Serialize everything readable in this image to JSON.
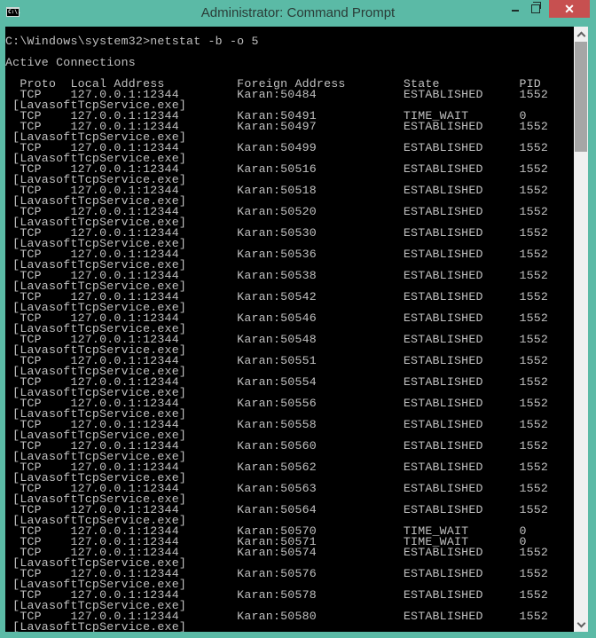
{
  "window": {
    "title": "Administrator: Command Prompt",
    "icon": "cmd-icon",
    "icon_glyph": "C:\\.",
    "controls": {
      "minimize": "minimize-icon",
      "maximize": "restore-icon",
      "close": "close-icon",
      "close_glyph": "✕"
    },
    "colors": {
      "frame": "#5bbaa6",
      "close": "#c75050",
      "console_bg": "#000000",
      "console_fg": "#c0c0c0",
      "scroll_track": "#f0f0f0",
      "scroll_thumb": "#a6a6a6"
    }
  },
  "console": {
    "prompt": "C:\\Windows\\system32>",
    "command": "netstat -b -o 5",
    "section_title": "Active Connections",
    "columns": [
      "Proto",
      "Local Address",
      "Foreign Address",
      "State",
      "PID"
    ],
    "rows": [
      {
        "proto": "TCP",
        "local": "127.0.0.1:12344",
        "foreign": "Karan:50484",
        "state": "ESTABLISHED",
        "pid": "1552",
        "process": "[LavasoftTcpService.exe]"
      },
      {
        "proto": "TCP",
        "local": "127.0.0.1:12344",
        "foreign": "Karan:50491",
        "state": "TIME_WAIT",
        "pid": "0",
        "process": ""
      },
      {
        "proto": "TCP",
        "local": "127.0.0.1:12344",
        "foreign": "Karan:50497",
        "state": "ESTABLISHED",
        "pid": "1552",
        "process": "[LavasoftTcpService.exe]"
      },
      {
        "proto": "TCP",
        "local": "127.0.0.1:12344",
        "foreign": "Karan:50499",
        "state": "ESTABLISHED",
        "pid": "1552",
        "process": "[LavasoftTcpService.exe]"
      },
      {
        "proto": "TCP",
        "local": "127.0.0.1:12344",
        "foreign": "Karan:50516",
        "state": "ESTABLISHED",
        "pid": "1552",
        "process": "[LavasoftTcpService.exe]"
      },
      {
        "proto": "TCP",
        "local": "127.0.0.1:12344",
        "foreign": "Karan:50518",
        "state": "ESTABLISHED",
        "pid": "1552",
        "process": "[LavasoftTcpService.exe]"
      },
      {
        "proto": "TCP",
        "local": "127.0.0.1:12344",
        "foreign": "Karan:50520",
        "state": "ESTABLISHED",
        "pid": "1552",
        "process": "[LavasoftTcpService.exe]"
      },
      {
        "proto": "TCP",
        "local": "127.0.0.1:12344",
        "foreign": "Karan:50530",
        "state": "ESTABLISHED",
        "pid": "1552",
        "process": "[LavasoftTcpService.exe]"
      },
      {
        "proto": "TCP",
        "local": "127.0.0.1:12344",
        "foreign": "Karan:50536",
        "state": "ESTABLISHED",
        "pid": "1552",
        "process": "[LavasoftTcpService.exe]"
      },
      {
        "proto": "TCP",
        "local": "127.0.0.1:12344",
        "foreign": "Karan:50538",
        "state": "ESTABLISHED",
        "pid": "1552",
        "process": "[LavasoftTcpService.exe]"
      },
      {
        "proto": "TCP",
        "local": "127.0.0.1:12344",
        "foreign": "Karan:50542",
        "state": "ESTABLISHED",
        "pid": "1552",
        "process": "[LavasoftTcpService.exe]"
      },
      {
        "proto": "TCP",
        "local": "127.0.0.1:12344",
        "foreign": "Karan:50546",
        "state": "ESTABLISHED",
        "pid": "1552",
        "process": "[LavasoftTcpService.exe]"
      },
      {
        "proto": "TCP",
        "local": "127.0.0.1:12344",
        "foreign": "Karan:50548",
        "state": "ESTABLISHED",
        "pid": "1552",
        "process": "[LavasoftTcpService.exe]"
      },
      {
        "proto": "TCP",
        "local": "127.0.0.1:12344",
        "foreign": "Karan:50551",
        "state": "ESTABLISHED",
        "pid": "1552",
        "process": "[LavasoftTcpService.exe]"
      },
      {
        "proto": "TCP",
        "local": "127.0.0.1:12344",
        "foreign": "Karan:50554",
        "state": "ESTABLISHED",
        "pid": "1552",
        "process": "[LavasoftTcpService.exe]"
      },
      {
        "proto": "TCP",
        "local": "127.0.0.1:12344",
        "foreign": "Karan:50556",
        "state": "ESTABLISHED",
        "pid": "1552",
        "process": "[LavasoftTcpService.exe]"
      },
      {
        "proto": "TCP",
        "local": "127.0.0.1:12344",
        "foreign": "Karan:50558",
        "state": "ESTABLISHED",
        "pid": "1552",
        "process": "[LavasoftTcpService.exe]"
      },
      {
        "proto": "TCP",
        "local": "127.0.0.1:12344",
        "foreign": "Karan:50560",
        "state": "ESTABLISHED",
        "pid": "1552",
        "process": "[LavasoftTcpService.exe]"
      },
      {
        "proto": "TCP",
        "local": "127.0.0.1:12344",
        "foreign": "Karan:50562",
        "state": "ESTABLISHED",
        "pid": "1552",
        "process": "[LavasoftTcpService.exe]"
      },
      {
        "proto": "TCP",
        "local": "127.0.0.1:12344",
        "foreign": "Karan:50563",
        "state": "ESTABLISHED",
        "pid": "1552",
        "process": "[LavasoftTcpService.exe]"
      },
      {
        "proto": "TCP",
        "local": "127.0.0.1:12344",
        "foreign": "Karan:50564",
        "state": "ESTABLISHED",
        "pid": "1552",
        "process": "[LavasoftTcpService.exe]"
      },
      {
        "proto": "TCP",
        "local": "127.0.0.1:12344",
        "foreign": "Karan:50570",
        "state": "TIME_WAIT",
        "pid": "0",
        "process": ""
      },
      {
        "proto": "TCP",
        "local": "127.0.0.1:12344",
        "foreign": "Karan:50571",
        "state": "TIME_WAIT",
        "pid": "0",
        "process": ""
      },
      {
        "proto": "TCP",
        "local": "127.0.0.1:12344",
        "foreign": "Karan:50574",
        "state": "ESTABLISHED",
        "pid": "1552",
        "process": "[LavasoftTcpService.exe]"
      },
      {
        "proto": "TCP",
        "local": "127.0.0.1:12344",
        "foreign": "Karan:50576",
        "state": "ESTABLISHED",
        "pid": "1552",
        "process": "[LavasoftTcpService.exe]"
      },
      {
        "proto": "TCP",
        "local": "127.0.0.1:12344",
        "foreign": "Karan:50578",
        "state": "ESTABLISHED",
        "pid": "1552",
        "process": "[LavasoftTcpService.exe]"
      },
      {
        "proto": "TCP",
        "local": "127.0.0.1:12344",
        "foreign": "Karan:50580",
        "state": "ESTABLISHED",
        "pid": "1552",
        "process": "[LavasoftTcpService.exe]"
      }
    ]
  },
  "scrollbar": {
    "up_icon": "chevron-up-icon",
    "down_icon": "chevron-down-icon"
  }
}
